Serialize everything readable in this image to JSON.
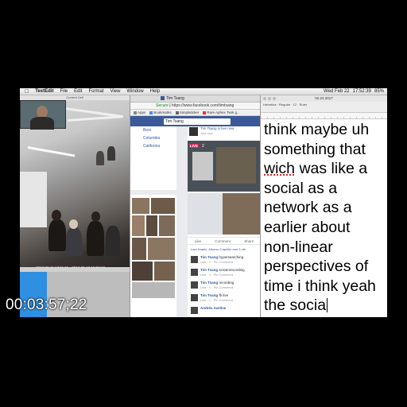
{
  "menubar": {
    "app": "TextEdit",
    "items": [
      "File",
      "Edit",
      "Format",
      "View",
      "Window",
      "Help"
    ],
    "status": [
      "Wed Feb 22",
      "17:52:39",
      "85%"
    ]
  },
  "camera_window": {
    "title": "Current Cell",
    "timestamp": "2017-02-11 17:11:41 · 2017-02-13 16:52:18"
  },
  "browser": {
    "tab_title": "Tim Tsang",
    "address_secure": "Secure",
    "address_url": "https://www.facebook.com/timtsang",
    "bookmarks": [
      "Apps",
      "Bookmarks",
      "Simplaticker",
      "Rare Aphex Twin g..."
    ],
    "fb_search": "Tim Tsang",
    "about_lines": [
      "Bost",
      "Columbia",
      "California"
    ],
    "post": {
      "name": "Tim Tsang is live now",
      "sub": "Just now",
      "live_label": "LIVE",
      "viewers": "2"
    },
    "actions": [
      "Like",
      "Comment",
      "Share"
    ],
    "likers": "Lars Kaaris, Alfonso Capelito and 3 oth",
    "comments": [
      {
        "name": "Tim Tsang",
        "text": "hypersearching",
        "meta": "Like · 1 · Pin Comment"
      },
      {
        "name": "Tim Tsang",
        "text": "screenrecording",
        "meta": "Like · 1 · Pin Comment"
      },
      {
        "name": "Tim Tsang",
        "text": "recording",
        "meta": "Like · 1 · Pin Comment"
      },
      {
        "name": "Tim Tsang",
        "text": "fb live",
        "meta": "Like · 1 · Pin Comment"
      },
      {
        "name": "Andrés Azeline",
        "text": "",
        "meta": ""
      }
    ]
  },
  "textedit": {
    "window_title": "02.22.2017",
    "toolbar": [
      "Helvetica",
      "Regular",
      "12",
      "Ruler"
    ],
    "lines": [
      "think maybe uh",
      "something that",
      "was like a",
      "social as a",
      "network as a",
      "earlier about",
      "non-linear",
      "perspectives of",
      "time i think yeah",
      "the socia"
    ],
    "misspelled_word": "wich"
  },
  "timecode": "00:03:57;22",
  "colors": {
    "facebook_blue": "#3b5998",
    "live_red": "#e0245e",
    "cam_blue": "#2f8fe0"
  }
}
